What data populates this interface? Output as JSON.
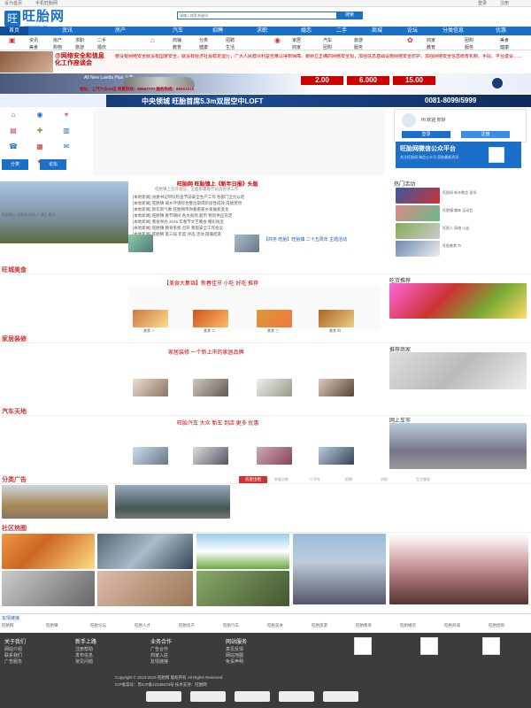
{
  "topbar": {
    "set_home": "设为首页",
    "mobile": "手机旺胎网",
    "login": "登录",
    "register": "注册"
  },
  "header": {
    "logo_text": "旺胎网",
    "logo_sub": "www.wtaiw.net",
    "search_placeholder": "请输入搜索关键词",
    "search_button": "搜索"
  },
  "nav": {
    "items": [
      "首页",
      "资讯",
      "房产",
      "汽车",
      "招聘",
      "求职",
      "婚恋",
      "二手",
      "商城",
      "论坛",
      "分类信息",
      "优惠"
    ]
  },
  "subnav": {
    "items": [
      "资讯",
      "房产",
      "求职",
      "二手",
      "商铺",
      "分类",
      "招聘",
      "家居",
      "汽车",
      "美食",
      "购物",
      "旅游",
      "婚庆",
      "教育",
      "健康",
      "生活",
      "商家",
      "团购",
      "服务"
    ]
  },
  "banners": {
    "b1_left": "@网络安全和信息化工作座谈会",
    "b1_right": "要没有网络安全就没有国家安全，就没有经济社会稳定运行，广大人民群众利益也难以得到保障。要树立正确的网络安全观，加强信息基础设施网络安全防护，加强网络安全信息统筹机制、手段、平台建设……",
    "b2_title": "All New Lavida Plus 上市",
    "b2_price1": "2.00",
    "b2_price2": "6.000",
    "b2_price3": "15.00",
    "b2_addr": "地址：上汽大众4S店  销售热线：88657777  服务热线：88691919",
    "b3_text": "中央领城  旺胎首席5.3m双层空中LOFT",
    "b3_phone": "0081-8099/5999"
  },
  "user_panel": {
    "greeting": "Hi 欢迎 你好",
    "login_btn": "登录",
    "register_btn": "注册"
  },
  "wechat": {
    "title": "旺胎网微信公众平台",
    "desc": "关注旺胎网 微信公众号 获取最新资讯"
  },
  "lead": {
    "title": "旺胎网 旺胎镇上《新年日报》头版",
    "subtitle": "旺胎镇上召开会议，全面部署春节前后各项工作",
    "items": [
      "[本地新闻] 县委书记带队检查节前安全生产工作 各部门全力以赴",
      "[本地新闻] 旺胎镇 城乡环境综合整治取得阶段性成效 成绩斐然",
      "[本地新闻] 新年新气象 旺胎网带你看看家乡发展新变化",
      "[本地新闻] 旺胎镇 春节期间 各大商场 超市 物资供应充足",
      "[本地新闻] 我县举办 2015 年春节文艺晚会 精彩纷呈",
      "[本地新闻] 旺胎镇 教育系统 召开 寒假安全工作会议",
      "[本地新闻] 旺胎网 第三届 年度 评选 活动 圆满结束"
    ],
    "bottom_left": "旺胎镇上 旺胎网 旺胎人 城区 周边",
    "bottom_right": "【商务 旺胎】旺胎镇 二十五周年 主题活动"
  },
  "hot": {
    "title": "热门活动",
    "items": [
      "旺胎网 新年晚会 现场",
      "旺胎镇 趣味 运动会",
      "旺胎人 网络 公益",
      "旺胎美食 节"
    ]
  },
  "sections": {
    "food": {
      "title": "旺城美食",
      "headline": "【美食大集锦】新春佳节 小吃 好吃 推荐",
      "right_title": "吃货推荐"
    },
    "home": {
      "title": "家居装修",
      "headline": "家居装修 一个新上市的家居品牌",
      "right_title": "推荐商家"
    },
    "car": {
      "title": "汽车天地",
      "headline": "旺胎汽车 大众 新车 到店 更多 优惠",
      "right_title": "网上车市"
    },
    "classified": {
      "title": "分类广告",
      "tabs": [
        "房屋出租",
        "房屋出售",
        "二手车",
        "招聘",
        "求职",
        "生活服务"
      ]
    },
    "photos": {
      "title": "社区热图"
    }
  },
  "food_items": [
    "美食 一",
    "美食 二",
    "美食 三",
    "美食 四"
  ],
  "links": {
    "title": "友情链接",
    "items": [
      "旺胎网",
      "旺胎镇",
      "旺胎论坛",
      "旺胎人才",
      "旺胎房产",
      "旺胎汽车",
      "旺胎美食",
      "旺胎旅游",
      "旺胎教育",
      "旺胎婚恋",
      "旺胎商城",
      "旺胎团购"
    ]
  },
  "footer": {
    "cols": [
      {
        "title": "关于我们",
        "items": [
          "网站介绍",
          "联系我们",
          "广告服务"
        ]
      },
      {
        "title": "新手上路",
        "items": [
          "注册帮助",
          "发布信息",
          "常见问题"
        ]
      },
      {
        "title": "业务合作",
        "items": [
          "广告合作",
          "商家入驻",
          "友情链接"
        ]
      },
      {
        "title": "网站服务",
        "items": [
          "意见反馈",
          "网站地图",
          "免责声明"
        ]
      }
    ],
    "copyright": "Copyright © 2013-2015 旺胎网 版权所有 All Rights Reserved",
    "icp": "ICP备案号：苏ICP备12345678号   技术支持：旺胎网"
  }
}
